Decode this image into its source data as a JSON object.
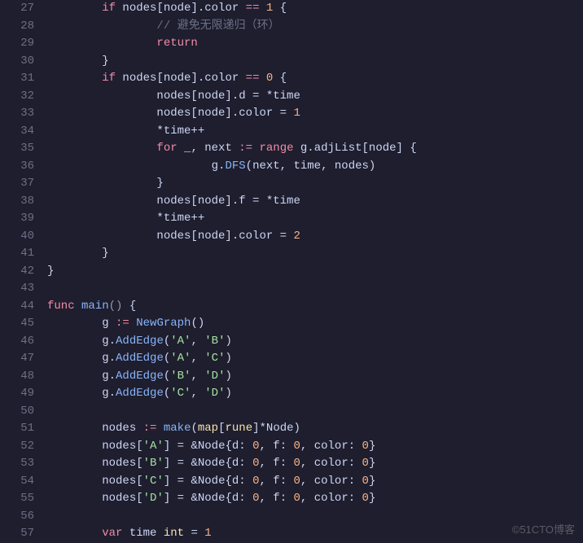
{
  "startLine": 27,
  "lines": [
    [
      {
        "indent": 2,
        "cls": "kw",
        "t": "if"
      },
      {
        "cls": "ident",
        "t": " nodes[node].color "
      },
      {
        "cls": "kw",
        "t": "=="
      },
      {
        "cls": "ident",
        "t": " "
      },
      {
        "cls": "num",
        "t": "1"
      },
      {
        "cls": "ident",
        "t": " {"
      }
    ],
    [
      {
        "indent": 4,
        "cls": "comment",
        "t": "// 避免无限递归（环）"
      }
    ],
    [
      {
        "indent": 4,
        "cls": "kw",
        "t": "return"
      }
    ],
    [
      {
        "indent": 2,
        "cls": "ident",
        "t": "}"
      }
    ],
    [
      {
        "indent": 2,
        "cls": "kw",
        "t": "if"
      },
      {
        "cls": "ident",
        "t": " nodes[node].color "
      },
      {
        "cls": "kw",
        "t": "=="
      },
      {
        "cls": "ident",
        "t": " "
      },
      {
        "cls": "num",
        "t": "0"
      },
      {
        "cls": "ident",
        "t": " {"
      }
    ],
    [
      {
        "indent": 4,
        "cls": "ident",
        "t": "nodes[node].d = *time"
      }
    ],
    [
      {
        "indent": 4,
        "cls": "ident",
        "t": "nodes[node].color = "
      },
      {
        "cls": "num",
        "t": "1"
      }
    ],
    [
      {
        "indent": 4,
        "cls": "ident",
        "t": "*time++"
      }
    ],
    [
      {
        "indent": 4,
        "cls": "kw",
        "t": "for"
      },
      {
        "cls": "ident",
        "t": " _, next "
      },
      {
        "cls": "kw",
        "t": ":="
      },
      {
        "cls": "ident",
        "t": " "
      },
      {
        "cls": "kw",
        "t": "range"
      },
      {
        "cls": "ident",
        "t": " g.adjList[node] {"
      }
    ],
    [
      {
        "indent": 6,
        "cls": "ident",
        "t": "g."
      },
      {
        "cls": "fn",
        "t": "DFS"
      },
      {
        "cls": "ident",
        "t": "(next, time, nodes)"
      }
    ],
    [
      {
        "indent": 4,
        "cls": "ident",
        "t": "}"
      }
    ],
    [
      {
        "indent": 4,
        "cls": "ident",
        "t": "nodes[node].f = *time"
      }
    ],
    [
      {
        "indent": 4,
        "cls": "ident",
        "t": "*time++"
      }
    ],
    [
      {
        "indent": 4,
        "cls": "ident",
        "t": "nodes[node].color = "
      },
      {
        "cls": "num",
        "t": "2"
      }
    ],
    [
      {
        "indent": 2,
        "cls": "ident",
        "t": "}"
      }
    ],
    [
      {
        "indent": 0,
        "cls": "ident",
        "t": "}"
      }
    ],
    [],
    [
      {
        "indent": 0,
        "cls": "kw",
        "t": "func"
      },
      {
        "cls": "ident",
        "t": " "
      },
      {
        "cls": "fn",
        "t": "main"
      },
      {
        "cls": "punct",
        "t": "()"
      },
      {
        "cls": "ident",
        "t": " {"
      }
    ],
    [
      {
        "indent": 2,
        "cls": "ident",
        "t": "g "
      },
      {
        "cls": "kw",
        "t": ":="
      },
      {
        "cls": "ident",
        "t": " "
      },
      {
        "cls": "fn",
        "t": "NewGraph"
      },
      {
        "cls": "ident",
        "t": "()"
      }
    ],
    [
      {
        "indent": 2,
        "cls": "ident",
        "t": "g."
      },
      {
        "cls": "fn",
        "t": "AddEdge"
      },
      {
        "cls": "ident",
        "t": "("
      },
      {
        "cls": "str",
        "t": "'A'"
      },
      {
        "cls": "ident",
        "t": ", "
      },
      {
        "cls": "str",
        "t": "'B'"
      },
      {
        "cls": "ident",
        "t": ")"
      }
    ],
    [
      {
        "indent": 2,
        "cls": "ident",
        "t": "g."
      },
      {
        "cls": "fn",
        "t": "AddEdge"
      },
      {
        "cls": "ident",
        "t": "("
      },
      {
        "cls": "str",
        "t": "'A'"
      },
      {
        "cls": "ident",
        "t": ", "
      },
      {
        "cls": "str",
        "t": "'C'"
      },
      {
        "cls": "ident",
        "t": ")"
      }
    ],
    [
      {
        "indent": 2,
        "cls": "ident",
        "t": "g."
      },
      {
        "cls": "fn",
        "t": "AddEdge"
      },
      {
        "cls": "ident",
        "t": "("
      },
      {
        "cls": "str",
        "t": "'B'"
      },
      {
        "cls": "ident",
        "t": ", "
      },
      {
        "cls": "str",
        "t": "'D'"
      },
      {
        "cls": "ident",
        "t": ")"
      }
    ],
    [
      {
        "indent": 2,
        "cls": "ident",
        "t": "g."
      },
      {
        "cls": "fn",
        "t": "AddEdge"
      },
      {
        "cls": "ident",
        "t": "("
      },
      {
        "cls": "str",
        "t": "'C'"
      },
      {
        "cls": "ident",
        "t": ", "
      },
      {
        "cls": "str",
        "t": "'D'"
      },
      {
        "cls": "ident",
        "t": ")"
      }
    ],
    [],
    [
      {
        "indent": 2,
        "cls": "ident",
        "t": "nodes "
      },
      {
        "cls": "kw",
        "t": ":="
      },
      {
        "cls": "ident",
        "t": " "
      },
      {
        "cls": "fn",
        "t": "make"
      },
      {
        "cls": "ident",
        "t": "("
      },
      {
        "cls": "type",
        "t": "map"
      },
      {
        "cls": "ident",
        "t": "["
      },
      {
        "cls": "type",
        "t": "rune"
      },
      {
        "cls": "ident",
        "t": "]*Node)"
      }
    ],
    [
      {
        "indent": 2,
        "cls": "ident",
        "t": "nodes["
      },
      {
        "cls": "str",
        "t": "'A'"
      },
      {
        "cls": "ident",
        "t": "] = &Node{d: "
      },
      {
        "cls": "num",
        "t": "0"
      },
      {
        "cls": "ident",
        "t": ", f: "
      },
      {
        "cls": "num",
        "t": "0"
      },
      {
        "cls": "ident",
        "t": ", color: "
      },
      {
        "cls": "num",
        "t": "0"
      },
      {
        "cls": "ident",
        "t": "}"
      }
    ],
    [
      {
        "indent": 2,
        "cls": "ident",
        "t": "nodes["
      },
      {
        "cls": "str",
        "t": "'B'"
      },
      {
        "cls": "ident",
        "t": "] = &Node{d: "
      },
      {
        "cls": "num",
        "t": "0"
      },
      {
        "cls": "ident",
        "t": ", f: "
      },
      {
        "cls": "num",
        "t": "0"
      },
      {
        "cls": "ident",
        "t": ", color: "
      },
      {
        "cls": "num",
        "t": "0"
      },
      {
        "cls": "ident",
        "t": "}"
      }
    ],
    [
      {
        "indent": 2,
        "cls": "ident",
        "t": "nodes["
      },
      {
        "cls": "str",
        "t": "'C'"
      },
      {
        "cls": "ident",
        "t": "] = &Node{d: "
      },
      {
        "cls": "num",
        "t": "0"
      },
      {
        "cls": "ident",
        "t": ", f: "
      },
      {
        "cls": "num",
        "t": "0"
      },
      {
        "cls": "ident",
        "t": ", color: "
      },
      {
        "cls": "num",
        "t": "0"
      },
      {
        "cls": "ident",
        "t": "}"
      }
    ],
    [
      {
        "indent": 2,
        "cls": "ident",
        "t": "nodes["
      },
      {
        "cls": "str",
        "t": "'D'"
      },
      {
        "cls": "ident",
        "t": "] = &Node{d: "
      },
      {
        "cls": "num",
        "t": "0"
      },
      {
        "cls": "ident",
        "t": ", f: "
      },
      {
        "cls": "num",
        "t": "0"
      },
      {
        "cls": "ident",
        "t": ", color: "
      },
      {
        "cls": "num",
        "t": "0"
      },
      {
        "cls": "ident",
        "t": "}"
      }
    ],
    [],
    [
      {
        "indent": 2,
        "cls": "kw",
        "t": "var"
      },
      {
        "cls": "ident",
        "t": " time "
      },
      {
        "cls": "type",
        "t": "int"
      },
      {
        "cls": "ident",
        "t": " = "
      },
      {
        "cls": "num",
        "t": "1"
      }
    ]
  ],
  "watermark": "©51CTO博客"
}
